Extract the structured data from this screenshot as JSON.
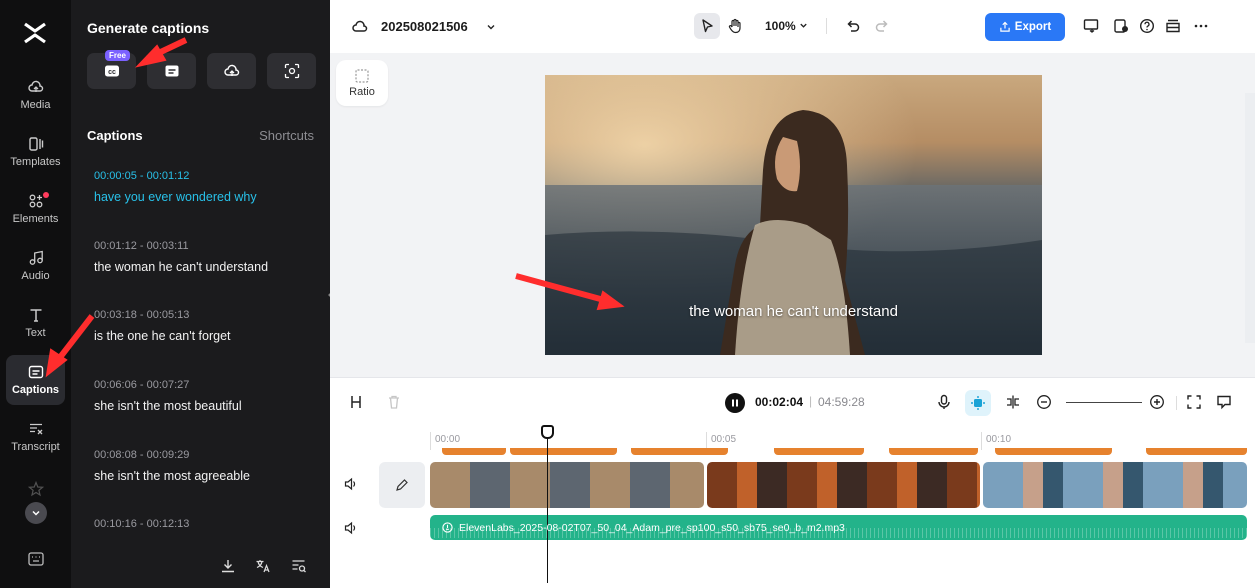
{
  "rail": {
    "items": [
      {
        "label": "Media",
        "icon": "cloud-icon"
      },
      {
        "label": "Templates",
        "icon": "templates-icon"
      },
      {
        "label": "Elements",
        "icon": "elements-icon"
      },
      {
        "label": "Audio",
        "icon": "music-note-icon"
      },
      {
        "label": "Text",
        "icon": "text-icon"
      },
      {
        "label": "Captions",
        "icon": "captions-icon",
        "active": true
      },
      {
        "label": "Transcript",
        "icon": "transcript-icon"
      }
    ]
  },
  "panel": {
    "title": "Generate captions",
    "free_badge": "Free",
    "captions_heading": "Captions",
    "shortcuts_label": "Shortcuts",
    "captions": [
      {
        "time": "00:00:05 - 00:01:12",
        "text": "have you ever wondered why"
      },
      {
        "time": "00:01:12 - 00:03:11",
        "text": "the woman he can't understand"
      },
      {
        "time": "00:03:18 - 00:05:13",
        "text": "is the one he can't forget"
      },
      {
        "time": "00:06:06 - 00:07:27",
        "text": "she isn't the most beautiful"
      },
      {
        "time": "00:08:08 - 00:09:29",
        "text": "she isn't the most agreeable"
      },
      {
        "time": "00:10:16 - 00:12:13",
        "text": ""
      }
    ]
  },
  "topbar": {
    "project_name": "202508021506",
    "zoom": "100%",
    "export_label": "Export"
  },
  "stage": {
    "ratio_label": "Ratio",
    "video_caption": "the woman he can't understand"
  },
  "timeline": {
    "current_time": "00:02:04",
    "separator": "|",
    "total_time": "04:59:28",
    "ruler_labels": [
      "00:00",
      "00:05",
      "00:10"
    ],
    "audio_file": "ElevenLabs_2025-08-02T07_50_04_Adam_pre_sp100_s50_sb75_se0_b_m2.mp3"
  },
  "colors": {
    "accent": "#2a78f6",
    "caption_highlight": "#28c0e8",
    "audio_track": "#23b38a",
    "caption_segment": "#e6822e",
    "annotation_arrow": "#ff2d2d"
  }
}
